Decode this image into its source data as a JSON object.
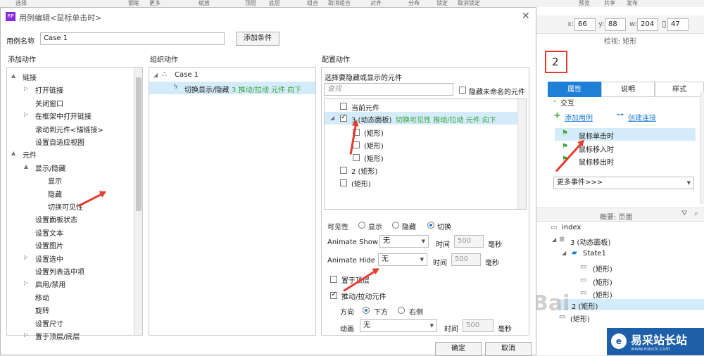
{
  "toolbar": {
    "items": [
      "选择",
      "钢笔",
      "更多",
      "缩放",
      "顶层",
      "底层",
      "组合",
      "取消组合",
      "对齐",
      "分布",
      "锁定",
      "取消锁定",
      "预览",
      "共享",
      "发布"
    ]
  },
  "dialog": {
    "title": "用例编辑<鼠标单击时>",
    "case_name_label": "用例名称",
    "case_name_value": "Case 1",
    "add_condition": "添加条件",
    "add_action_title": "添加动作",
    "organize_title": "组织动作",
    "config_title": "配置动作",
    "ok": "确定",
    "cancel": "取消"
  },
  "add_actions": [
    {
      "label": "链接",
      "indent": 0,
      "arrow": "▲"
    },
    {
      "label": "打开链接",
      "indent": 1,
      "arrow": "▷"
    },
    {
      "label": "关闭窗口",
      "indent": 1,
      "arrow": ""
    },
    {
      "label": "在框架中打开链接",
      "indent": 1,
      "arrow": "▷"
    },
    {
      "label": "滚动到元件<锚链接>",
      "indent": 1,
      "arrow": ""
    },
    {
      "label": "设置自适应视图",
      "indent": 1,
      "arrow": ""
    },
    {
      "label": "元件",
      "indent": 0,
      "arrow": "▲"
    },
    {
      "label": "显示/隐藏",
      "indent": 1,
      "arrow": "▲"
    },
    {
      "label": "显示",
      "indent": 2,
      "arrow": ""
    },
    {
      "label": "隐藏",
      "indent": 2,
      "arrow": ""
    },
    {
      "label": "切换可见性",
      "indent": 2,
      "arrow": ""
    },
    {
      "label": "设置面板状态",
      "indent": 1,
      "arrow": ""
    },
    {
      "label": "设置文本",
      "indent": 1,
      "arrow": ""
    },
    {
      "label": "设置图片",
      "indent": 1,
      "arrow": ""
    },
    {
      "label": "设置选中",
      "indent": 1,
      "arrow": "▷"
    },
    {
      "label": "设置列表选中项",
      "indent": 1,
      "arrow": ""
    },
    {
      "label": "启用/禁用",
      "indent": 1,
      "arrow": "▷"
    },
    {
      "label": "移动",
      "indent": 1,
      "arrow": ""
    },
    {
      "label": "旋转",
      "indent": 1,
      "arrow": ""
    },
    {
      "label": "设置尺寸",
      "indent": 1,
      "arrow": ""
    },
    {
      "label": "置于顶层/底层",
      "indent": 1,
      "arrow": "▷"
    }
  ],
  "organize": {
    "case": "Case 1",
    "action_prefix": "切换显示/隐藏",
    "action_detail": "3 推动/拉动 元件 向下"
  },
  "config": {
    "select_title": "选择要隐藏或显示的元件",
    "search_placeholder": "查找",
    "hide_unnamed": "隐藏未命名的元件",
    "current": "当前元件",
    "item3": "3 (动态面板)",
    "item3_detail": "切换可见性 推动/拉动 元件 向下",
    "rect": "(矩形)",
    "item2": "2 (矩形)",
    "visibility_label": "可见性",
    "vis_show": "显示",
    "vis_hide": "隐藏",
    "vis_toggle": "切换",
    "animate_show": "Animate Show",
    "animate_hide": "Animate Hide",
    "none": "无",
    "time": "时间",
    "ms": "毫秒",
    "time_value": "500",
    "bring_front": "置于顶层",
    "push_pull": "推动/拉动元件",
    "direction": "方向",
    "down": "下方",
    "right": "右侧",
    "animation": "动画"
  },
  "right": {
    "x_label": "x:",
    "x": "66",
    "y_label": "y:",
    "y": "88",
    "w_label": "w:",
    "w": "204",
    "h": "47",
    "inspect_title": "检视: 矩形",
    "name_value": "2",
    "tab_props": "属性",
    "tab_notes": "说明",
    "tab_style": "样式",
    "interaction": "交互",
    "add_case": "添加用例",
    "create_link": "创建连接",
    "ev_click": "鼠标单击时",
    "ev_enter": "鼠标移入时",
    "ev_leave": "鼠标移出时",
    "more_events": "更多事件>>>",
    "outline_title": "概要: 页面",
    "index": "index",
    "dp": "3 (动态面板)",
    "state": "State1",
    "rect": "(矩形)",
    "rect2": "2 (矩形)"
  },
  "watermark": {
    "text": "易采站长站",
    "url": "www.easck.com",
    "baidu": "Bai"
  },
  "colors": {
    "accent": "#1e7fd6",
    "green": "#3aa33a",
    "highlight": "#d4ecf9",
    "arrow": "#e43d2f"
  }
}
